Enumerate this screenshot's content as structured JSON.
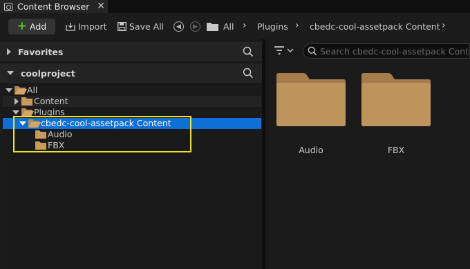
{
  "tab": {
    "title": "Content Browser",
    "close": "✕"
  },
  "toolbar": {
    "add_label": "Add",
    "import_label": "Import",
    "save_all_label": "Save All"
  },
  "breadcrumbs": [
    "All",
    "Plugins",
    "cbedc-cool-assetpack Content"
  ],
  "sidebar": {
    "favorites_title": "Favorites",
    "project_title": "coolproject"
  },
  "tree": [
    {
      "label": "All"
    },
    {
      "label": "Content"
    },
    {
      "label": "Plugins"
    },
    {
      "label": "cbedc-cool-assetpack Content"
    },
    {
      "label": "Audio"
    },
    {
      "label": "FBX"
    }
  ],
  "search": {
    "placeholder": "Search cbedc-cool-assetpack Content"
  },
  "assets": [
    {
      "label": "Audio"
    },
    {
      "label": "FBX"
    }
  ],
  "colors": {
    "folder": "#b58a55",
    "selection": "#0e6fd6",
    "highlight": "#f2e21c",
    "add_plus": "#5fc02e"
  }
}
